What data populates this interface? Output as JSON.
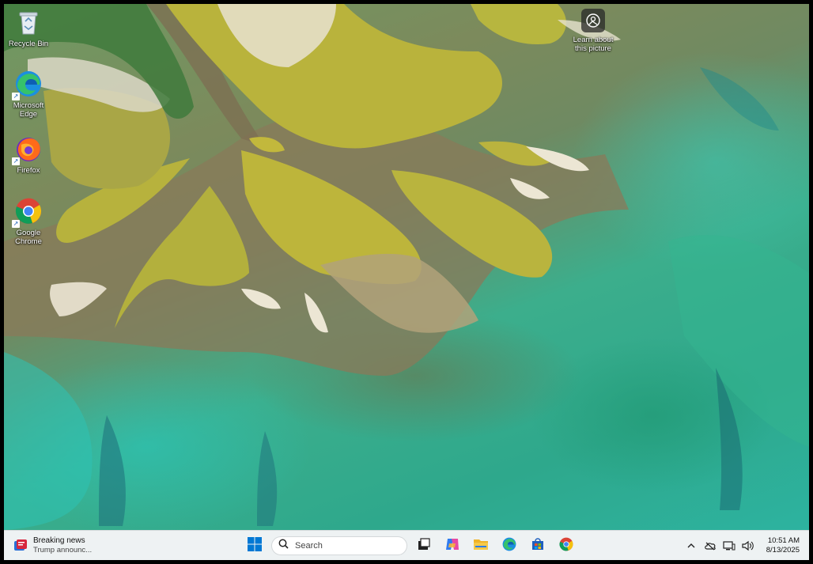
{
  "desktop": {
    "icons": [
      {
        "label": "Recycle Bin",
        "icon": "recycle-bin-icon"
      },
      {
        "label": "Microsoft Edge",
        "icon": "edge-icon"
      },
      {
        "label": "Firefox",
        "icon": "firefox-icon"
      },
      {
        "label": "Google Chrome",
        "icon": "chrome-icon"
      }
    ],
    "learn_about": {
      "label": "Learn about this picture",
      "icon": "camera-info-icon"
    }
  },
  "taskbar": {
    "news": {
      "title": "Breaking news",
      "subtitle": "Trump announc...",
      "icon": "news-icon"
    },
    "start_icon": "windows-start-icon",
    "search_placeholder": "Search",
    "pinned": [
      "task-view-icon",
      "copilot-icon",
      "file-explorer-icon",
      "edge-icon",
      "microsoft-store-icon",
      "chrome-icon"
    ],
    "tray": {
      "icons": [
        "chevron-up-icon",
        "onedrive-icon",
        "network-icon",
        "volume-icon"
      ],
      "time": "10:51 AM",
      "date": "8/13/2025"
    }
  },
  "colors": {
    "taskbar_bg": "#eef2f3",
    "accent_blue": "#0078d4"
  }
}
